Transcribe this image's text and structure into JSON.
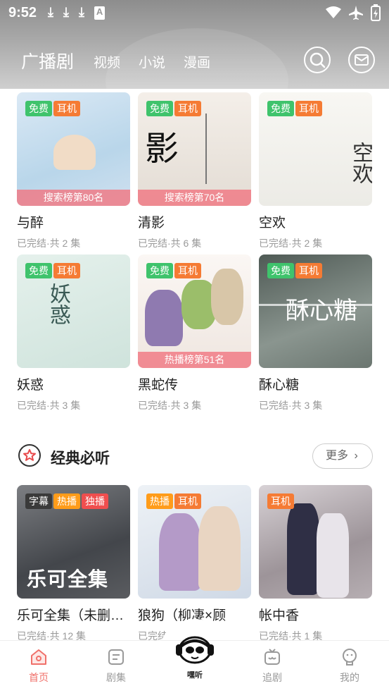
{
  "status": {
    "time": "9:52",
    "icons": [
      "download-icon",
      "download-icon",
      "download-icon",
      "a-icon"
    ]
  },
  "nav": {
    "tabs": [
      {
        "label": "广播剧",
        "active": true
      },
      {
        "label": "视频"
      },
      {
        "label": "小说"
      },
      {
        "label": "漫画"
      }
    ]
  },
  "grid": [
    {
      "title": "与醉",
      "sub": "已完结·共 2 集",
      "tags": [
        "免费",
        "耳机"
      ],
      "rank": "搜索榜第80名",
      "bg": "#cfe4f2"
    },
    {
      "title": "清影",
      "sub": "已完结·共 6 集",
      "tags": [
        "免费",
        "耳机"
      ],
      "rank": "搜索榜第70名",
      "bg": "#e9e3dd"
    },
    {
      "title": "空欢",
      "sub": "已完结·共 2 集",
      "tags": [
        "免费",
        "耳机"
      ],
      "rank": "",
      "bg": "#f3f1ec"
    },
    {
      "title": "妖惑",
      "sub": "已完结·共 3 集",
      "tags": [
        "免费",
        "耳机"
      ],
      "rank": "",
      "bg": "#dcebe6"
    },
    {
      "title": "黑蛇传",
      "sub": "已完结·共 3 集",
      "tags": [
        "免费",
        "耳机"
      ],
      "rank": "热播榜第51名",
      "bg": "#efe7e2"
    },
    {
      "title": "酥心糖",
      "sub": "已完结·共 3 集",
      "tags": [
        "免费",
        "耳机"
      ],
      "rank": "",
      "bg": "#6f7a74"
    }
  ],
  "section": {
    "title": "经典必听",
    "more": "更多"
  },
  "classics": [
    {
      "title": "乐可全集（未删减）",
      "sub": "已完结·共 12 集",
      "tags": [
        "字幕",
        "热播",
        "独播"
      ],
      "cover_text": "乐可全集",
      "bg": "#5d5f63"
    },
    {
      "title": "狼狗（柳凄×顾",
      "sub": "已完结·共",
      "tags": [
        "热播",
        "耳机"
      ],
      "bg": "#dfe6ee"
    },
    {
      "title": "帐中香",
      "sub": "已完结·共 1 集",
      "tags": [
        "耳机"
      ],
      "bg": "#b8b1b4"
    }
  ],
  "bottom_nav": [
    {
      "label": "首页",
      "active": true,
      "icon": "home-icon"
    },
    {
      "label": "剧集",
      "icon": "list-icon"
    },
    {
      "label": "追剧",
      "icon": "tv-icon"
    },
    {
      "label": "我的",
      "icon": "profile-icon"
    }
  ],
  "center_badge": "嘿听"
}
